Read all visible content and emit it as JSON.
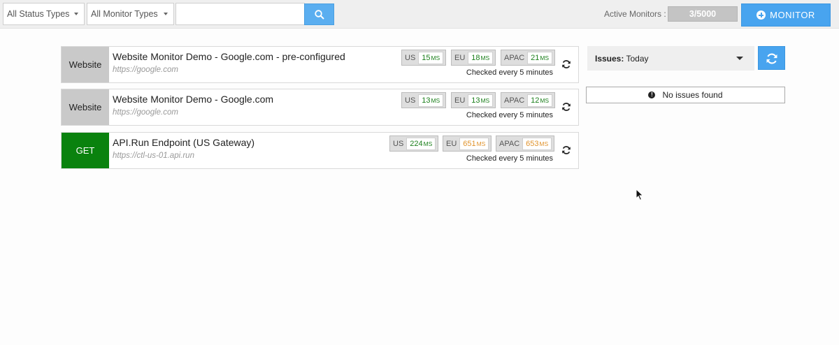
{
  "toolbar": {
    "status_filter": "All Status Types",
    "monitor_type_filter": "All Monitor Types",
    "search_value": "",
    "search_icon": "search-icon",
    "active_monitors_label": "Active Monitors :",
    "active_monitors_count": "3/5000",
    "add_monitor_label": "MONITOR"
  },
  "monitors": [
    {
      "type": "Website",
      "name": "Website Monitor Demo - Google.com - pre-configured",
      "url": "https://google.com",
      "regions": [
        {
          "label": "US",
          "value": "15",
          "unit": "MS",
          "status": "green"
        },
        {
          "label": "EU",
          "value": "18",
          "unit": "MS",
          "status": "green"
        },
        {
          "label": "APAC",
          "value": "21",
          "unit": "MS",
          "status": "green"
        }
      ],
      "checked": "Checked every 5 minutes"
    },
    {
      "type": "Website",
      "name": "Website Monitor Demo - Google.com",
      "url": "https://google.com",
      "regions": [
        {
          "label": "US",
          "value": "13",
          "unit": "MS",
          "status": "green"
        },
        {
          "label": "EU",
          "value": "13",
          "unit": "MS",
          "status": "green"
        },
        {
          "label": "APAC",
          "value": "12",
          "unit": "MS",
          "status": "green"
        }
      ],
      "checked": "Checked every 5 minutes"
    },
    {
      "type": "GET",
      "name": "API.Run Endpoint (US Gateway)",
      "url": "https://ctl-us-01.api.run",
      "regions": [
        {
          "label": "US",
          "value": "224",
          "unit": "MS",
          "status": "green"
        },
        {
          "label": "EU",
          "value": "651",
          "unit": "MS",
          "status": "orange"
        },
        {
          "label": "APAC",
          "value": "653",
          "unit": "MS",
          "status": "orange"
        }
      ],
      "checked": "Checked every 5 minutes"
    }
  ],
  "issues": {
    "filter_label": "Issues:",
    "filter_value": "Today",
    "empty_message": "No issues found"
  },
  "colors": {
    "accent": "#48a4ef",
    "get_badge": "#0a820e",
    "ok": "#1b7f1b",
    "warn": "#e0932c"
  }
}
